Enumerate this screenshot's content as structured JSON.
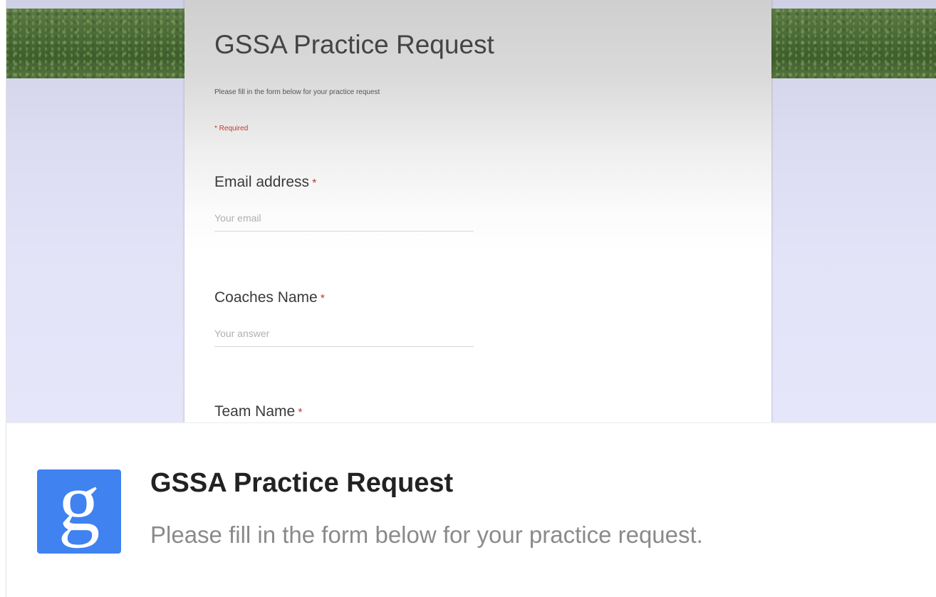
{
  "form": {
    "title": "GSSA Practice Request",
    "description": "Please fill in the form below for your practice request",
    "required_note": "* Required",
    "questions": [
      {
        "label": "Email address",
        "required_mark": "*",
        "placeholder": "Your email"
      },
      {
        "label": "Coaches Name",
        "required_mark": "*",
        "placeholder": "Your answer"
      },
      {
        "label": "Team Name",
        "required_mark": "*"
      }
    ]
  },
  "link_card": {
    "logo_letter": "g",
    "logo_icon": "google-logo-icon",
    "title": "GSSA Practice Request",
    "description": "Please fill in the form below for your practice request."
  },
  "colors": {
    "logo_bg": "#3f82f0",
    "required_red": "#c0392b"
  }
}
